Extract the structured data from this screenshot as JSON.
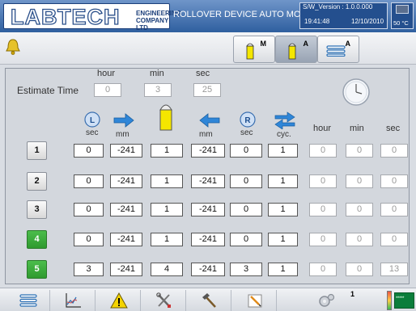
{
  "header": {
    "logo_lab": "LAB",
    "logo_tech": "TECH",
    "logo_sub": "ENGINEERING COMPANY LTD",
    "title": "ROLLOVER DEVICE AUTO MODE",
    "version": "S/W_Version :  1.0.0.000",
    "time": "19:41:48",
    "date": "12/10/2010",
    "temperature": "50 °C",
    "colors": {
      "bar": "#2f5f9f",
      "bar_light": "#6f95c9"
    }
  },
  "toolbar": {
    "alarm_icon": "bell-icon",
    "modes": [
      {
        "label": "M",
        "icon": "cylinder-icon",
        "active": false
      },
      {
        "label": "A",
        "icon": "cylinder-icon",
        "active": true
      },
      {
        "label": "A",
        "icon": "list-icon",
        "active": false
      }
    ]
  },
  "estimate": {
    "label": "Estimate Time",
    "hour_label": "hour",
    "min_label": "min",
    "sec_label": "sec",
    "hour": "0",
    "min": "3",
    "sec": "25"
  },
  "columns": {
    "sec_left": "sec",
    "mm_right": "mm",
    "mm_left": "mm",
    "sec_right": "sec",
    "cyc": "cyc.",
    "hour": "hour",
    "min": "min",
    "sec": "sec"
  },
  "rows": [
    {
      "id": "1",
      "active": false,
      "v1": "0",
      "v2": "-241",
      "v3": "1",
      "v4": "-241",
      "v5": "0",
      "v6": "1",
      "h": "0",
      "m": "0",
      "s": "0"
    },
    {
      "id": "2",
      "active": false,
      "v1": "0",
      "v2": "-241",
      "v3": "1",
      "v4": "-241",
      "v5": "0",
      "v6": "1",
      "h": "0",
      "m": "0",
      "s": "0"
    },
    {
      "id": "3",
      "active": false,
      "v1": "0",
      "v2": "-241",
      "v3": "1",
      "v4": "-241",
      "v5": "0",
      "v6": "1",
      "h": "0",
      "m": "0",
      "s": "0"
    },
    {
      "id": "4",
      "active": true,
      "v1": "0",
      "v2": "-241",
      "v3": "1",
      "v4": "-241",
      "v5": "0",
      "v6": "1",
      "h": "0",
      "m": "0",
      "s": "0"
    },
    {
      "id": "5",
      "active": true,
      "v1": "3",
      "v2": "-241",
      "v3": "4",
      "v4": "-241",
      "v5": "3",
      "v6": "1",
      "h": "0",
      "m": "0",
      "s": "13"
    }
  ],
  "bottombar": {
    "items": [
      "menu-icon",
      "chart-icon",
      "warning-icon",
      "tools-icon",
      "hammer-icon",
      "pencil-icon",
      "gear-icon"
    ],
    "gear_count": "1",
    "led_text": "*****"
  }
}
